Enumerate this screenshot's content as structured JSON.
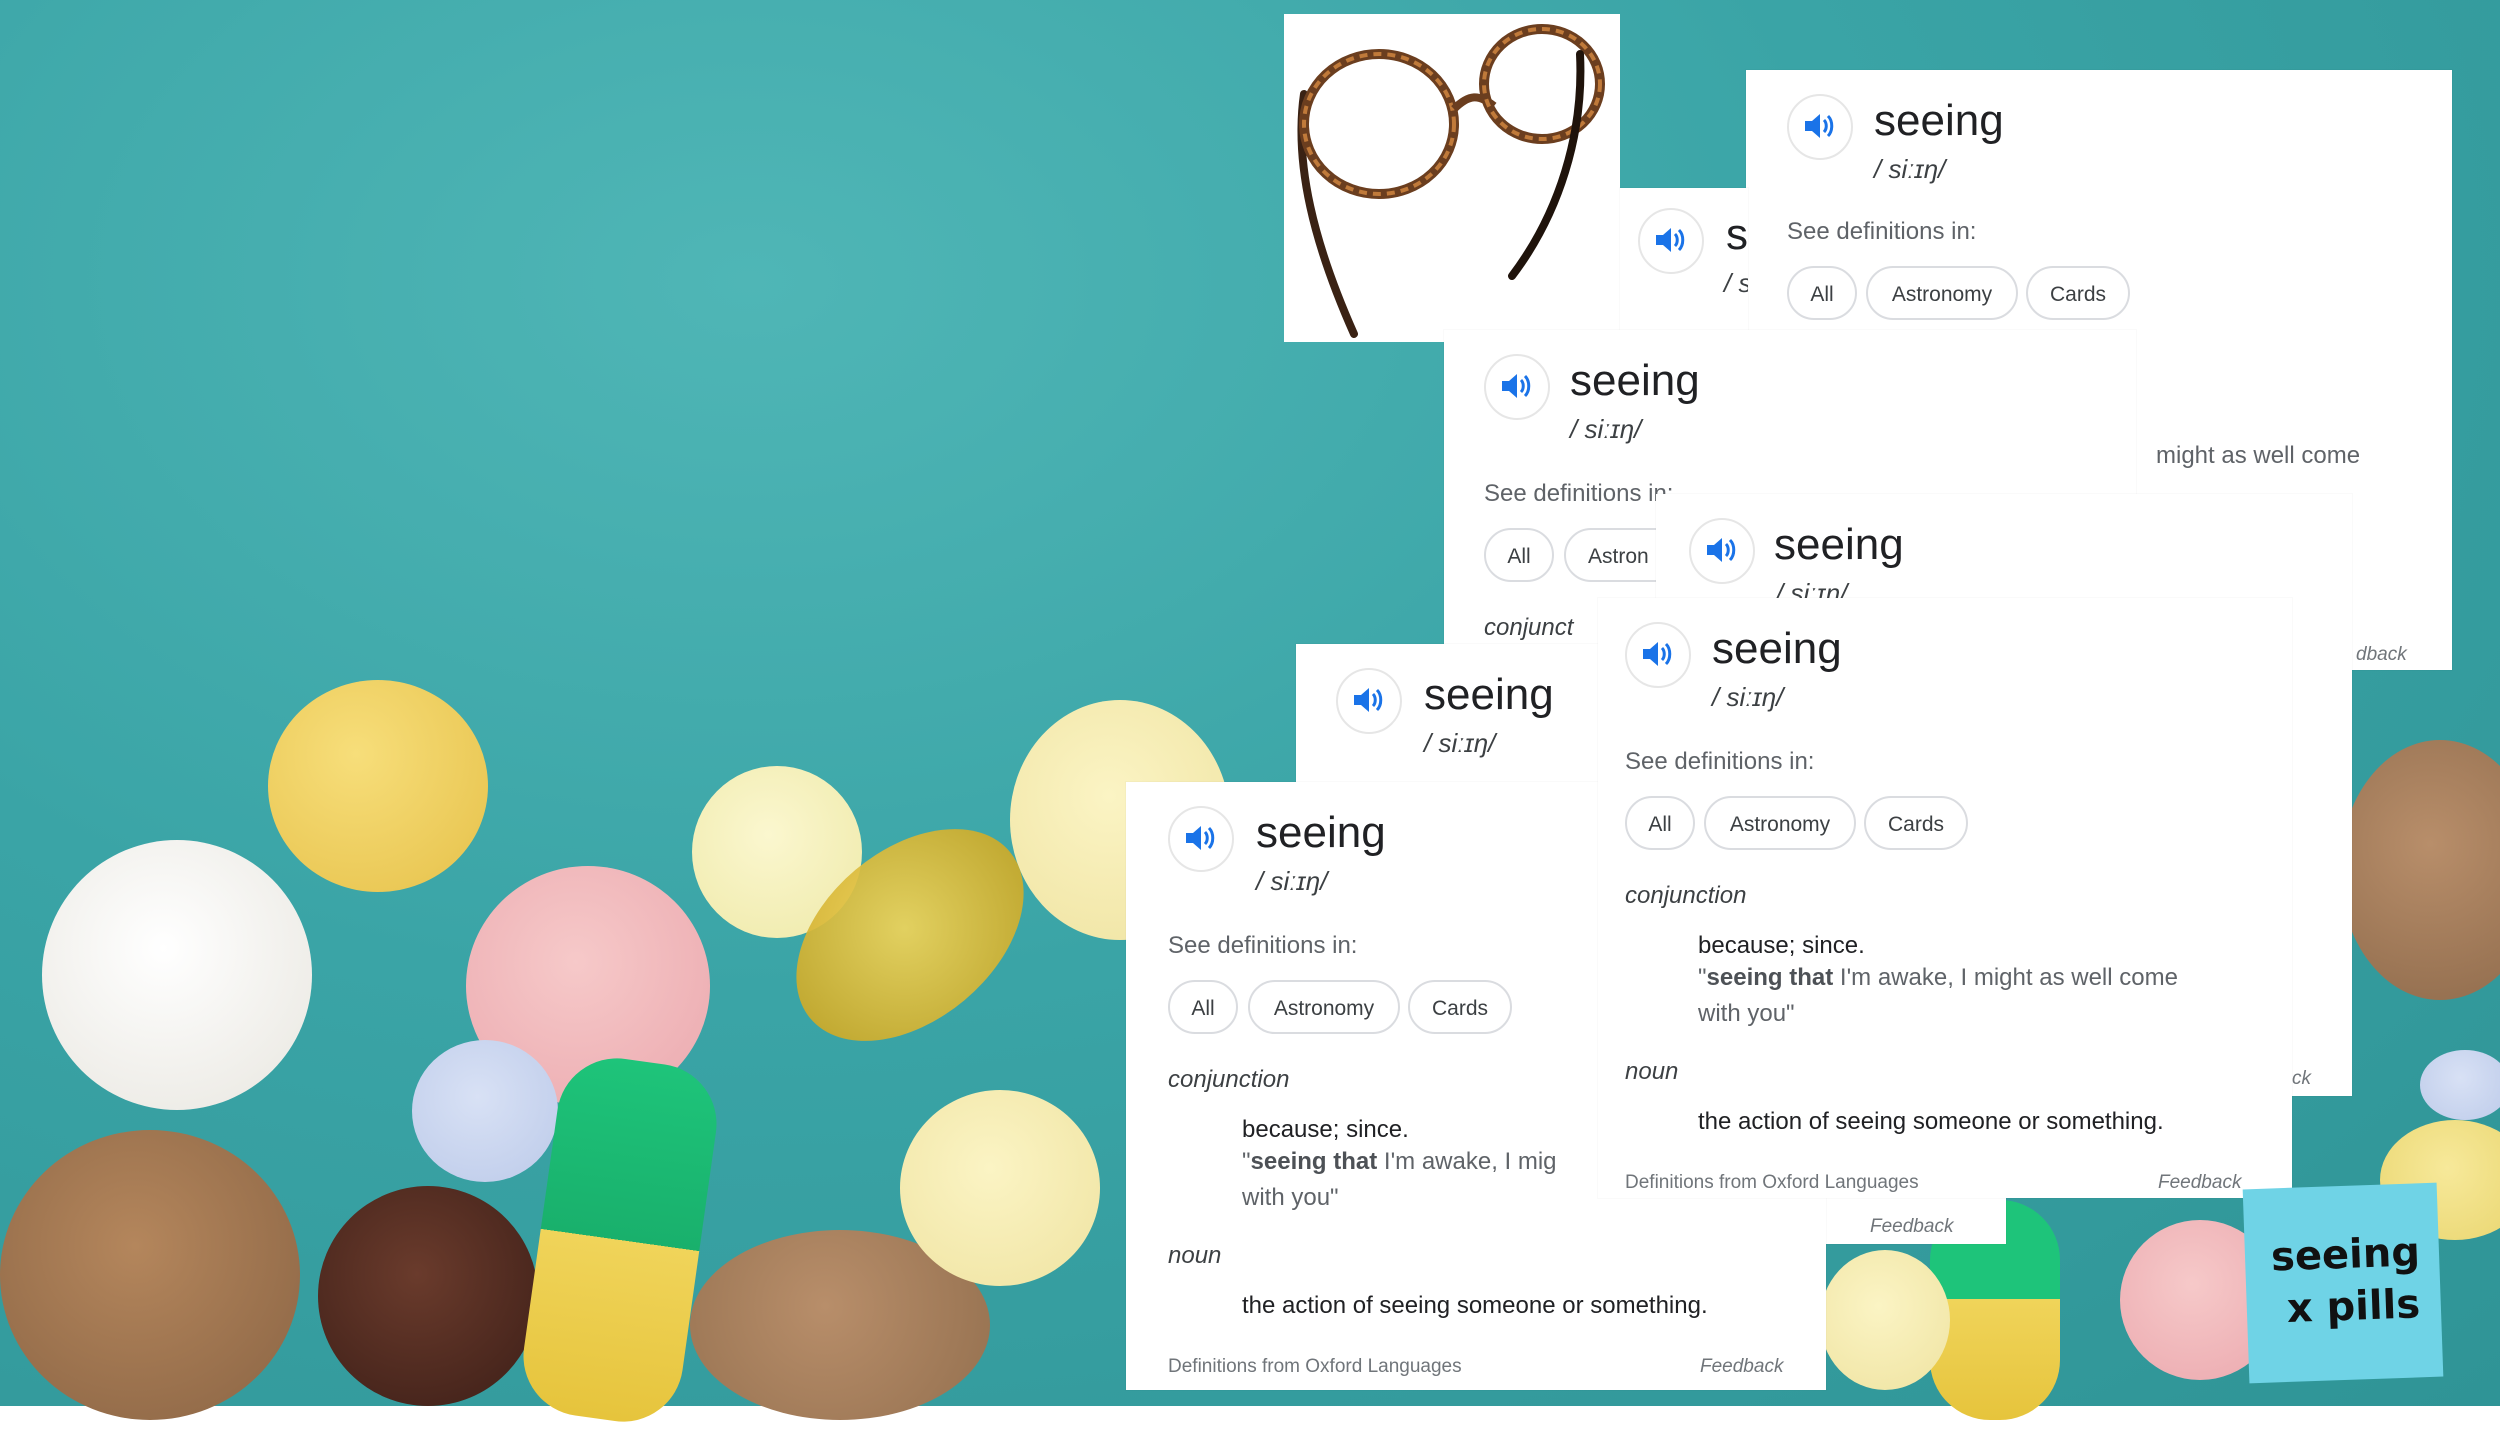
{
  "word": "seeing",
  "phonetic": "/ siːɪŋ/",
  "see_definitions": "See definitions in:",
  "chips": [
    "All",
    "Astronomy",
    "Cards"
  ],
  "chip_fragment": "Astron",
  "part1": "conjunction",
  "part1_fragment": "conjunct",
  "definition1": "because; since.",
  "example_bold": "seeing that",
  "example_rest_full": " I'm awake, I might as well come",
  "example_rest_partial": " I'm awake, I mig",
  "example_line2": "with you\"",
  "fragment_might": "might as well come",
  "part2": "noun",
  "definition2": "the action of seeing someone or something.",
  "source": "Definitions from Oxford Languages",
  "feedback": "Feedback",
  "feedback_fragment_1": "dback",
  "feedback_fragment_2": "ck",
  "truncated_word": "s",
  "truncated_phonetic": "/ s",
  "sticky_line1": "seeing",
  "sticky_line2": "x pills",
  "colors": {
    "background": "#3aa4a6",
    "speaker_blue": "#1a73e8",
    "sticky_note": "#6fd3e6"
  },
  "icons": [
    "speaker-icon",
    "eyeglasses-icon"
  ]
}
